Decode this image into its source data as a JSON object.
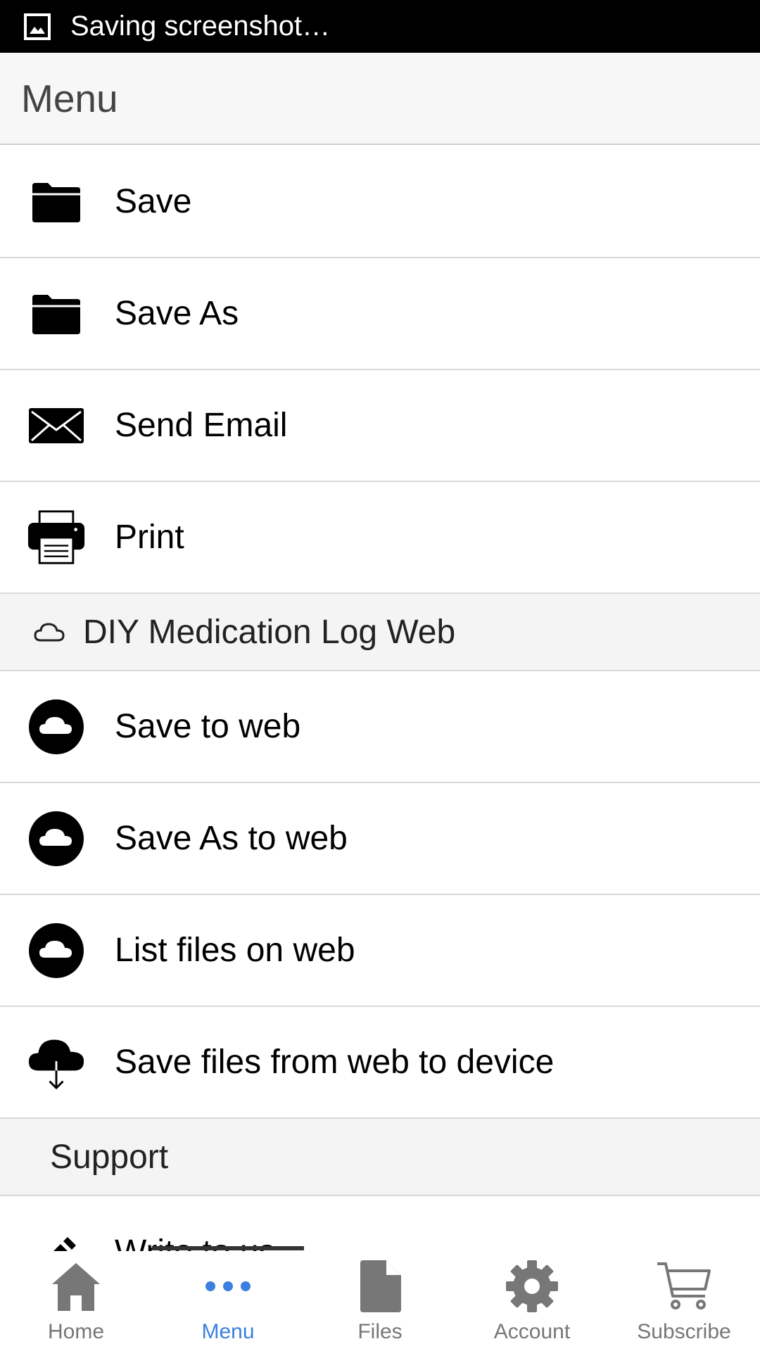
{
  "status_bar": {
    "notification": "Saving screenshot…"
  },
  "header": {
    "title": "Menu"
  },
  "menu": {
    "items": [
      {
        "label": "Save",
        "icon": "folder-icon"
      },
      {
        "label": "Save As",
        "icon": "folder-icon"
      },
      {
        "label": "Send Email",
        "icon": "envelope-icon"
      },
      {
        "label": "Print",
        "icon": "printer-icon"
      }
    ],
    "web_section": {
      "label": "DIY Medication Log Web",
      "icon": "cloud-outline-icon"
    },
    "web_items": [
      {
        "label": "Save to web",
        "icon": "cloud-circle-icon"
      },
      {
        "label": "Save As to web",
        "icon": "cloud-circle-icon"
      },
      {
        "label": "List files on web",
        "icon": "cloud-circle-icon"
      },
      {
        "label": "Save files from web to device",
        "icon": "cloud-download-icon"
      }
    ],
    "support_section": {
      "label": "Support"
    },
    "support_items": [
      {
        "label": "Write to us",
        "icon": "pencil-icon"
      }
    ]
  },
  "tabbar": {
    "tabs": [
      {
        "label": "Home",
        "icon": "home-icon"
      },
      {
        "label": "Menu",
        "icon": "more-dots-icon",
        "active": true
      },
      {
        "label": "Files",
        "icon": "file-icon"
      },
      {
        "label": "Account",
        "icon": "gear-icon"
      },
      {
        "label": "Subscribe",
        "icon": "cart-icon"
      }
    ],
    "active_color": "#3b7fe0",
    "inactive_color": "#777777"
  }
}
